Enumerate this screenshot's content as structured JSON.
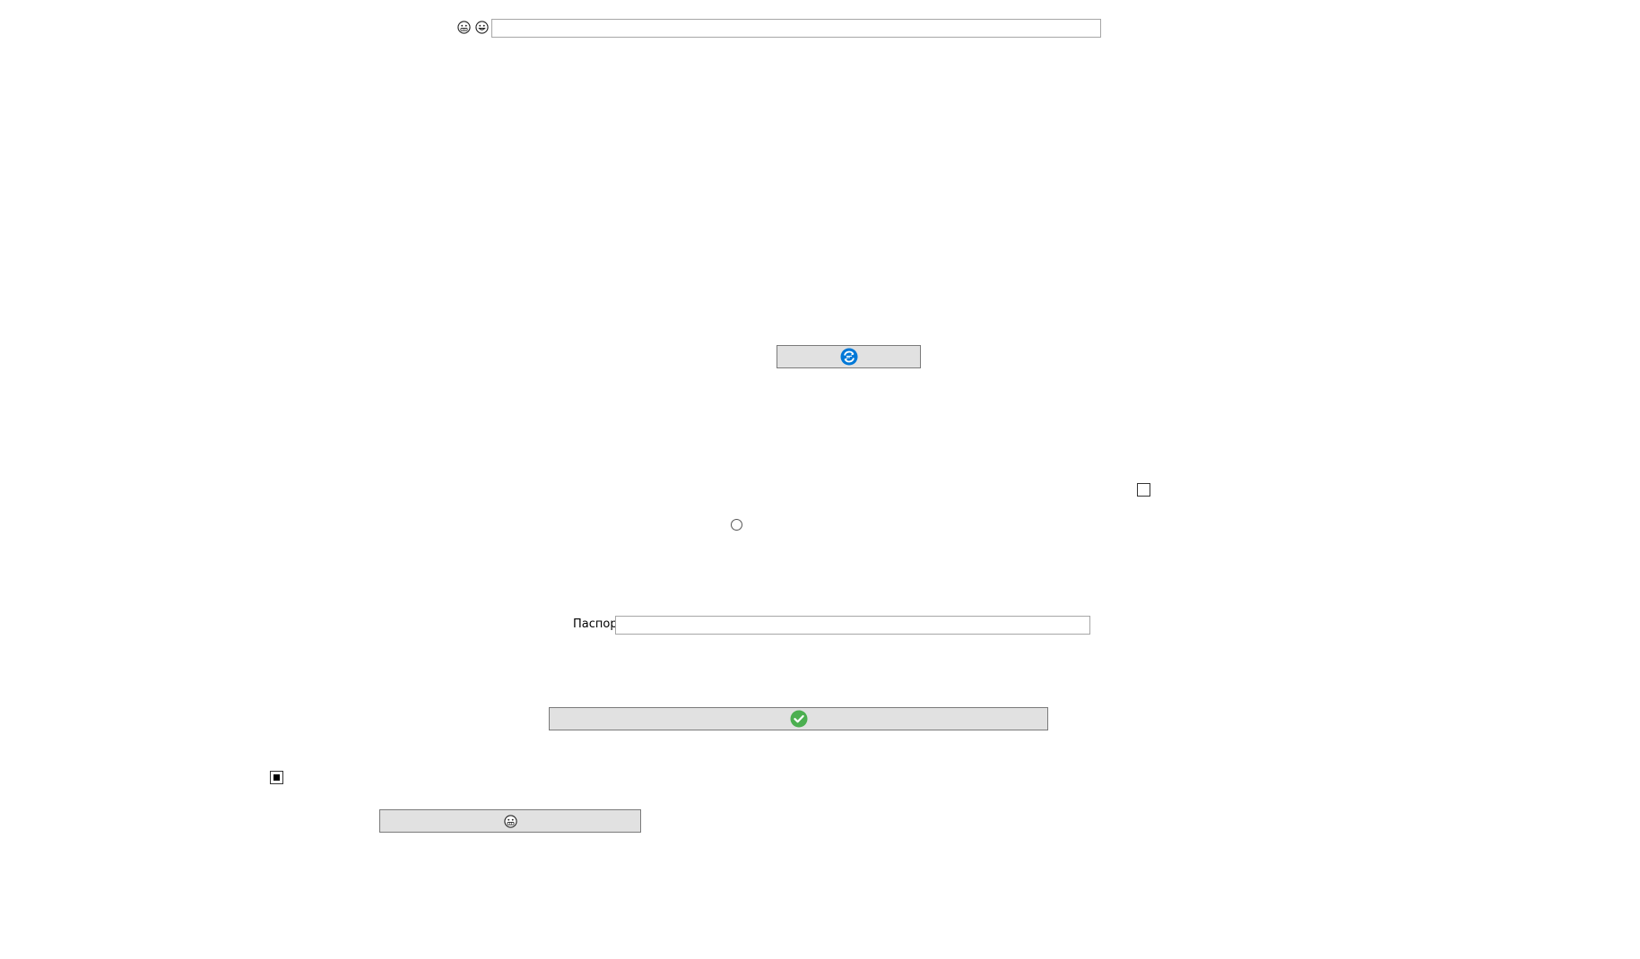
{
  "top_bar": {
    "icons": [
      "grimace-face-icon",
      "grin-face-icon"
    ],
    "search": {
      "value": "",
      "placeholder": ""
    }
  },
  "refresh_button": {
    "label": "",
    "icon": "refresh-icon",
    "icon_color": "#0078d7"
  },
  "checkbox_right": {
    "checked": false
  },
  "radio_option": {
    "selected": false
  },
  "passport": {
    "label": "Паспорт",
    "value": "",
    "placeholder": ""
  },
  "confirm_button": {
    "label": "",
    "icon": "check-circle-icon",
    "icon_color": "#4caf50"
  },
  "checkbox_left": {
    "checked": true
  },
  "emoji_button": {
    "label": "",
    "icon": "grimace-face-icon"
  }
}
